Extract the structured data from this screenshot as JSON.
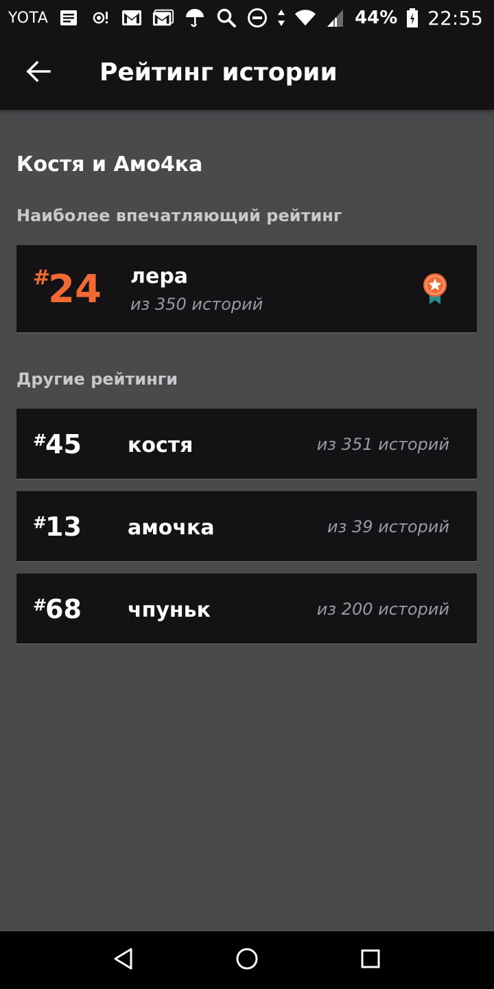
{
  "status_bar": {
    "carrier": "YOTA",
    "battery": "44%",
    "time": "22:55",
    "icons": [
      "message-icon",
      "hotspot-icon",
      "gmail-icon",
      "gmail-icon",
      "umbrella-icon",
      "search-icon",
      "dnd-icon",
      "data-arrows-icon",
      "wifi-icon",
      "signal-icon",
      "battery-icon"
    ]
  },
  "app_bar": {
    "title": "Рейтинг истории",
    "back_icon": "arrow-left-icon"
  },
  "story": {
    "name": "Костя и Амо4ка"
  },
  "best": {
    "section_label": "Наиболее впечатляющий рейтинг",
    "hash": "#",
    "rank": "24",
    "name": "лера",
    "sub": "из 350 историй",
    "badge_icon": "medal-icon",
    "accent": "#f26a33",
    "badge_ribbon": "#2a8f8f"
  },
  "others": {
    "section_label": "Другие рейтинги",
    "items": [
      {
        "hash": "#",
        "rank": "45",
        "name": "костя",
        "sub": "из 351 историй"
      },
      {
        "hash": "#",
        "rank": "13",
        "name": "амочка",
        "sub": "из 39 историй"
      },
      {
        "hash": "#",
        "rank": "68",
        "name": "чпуньк",
        "sub": "из 200 историй"
      }
    ]
  },
  "nav_bar": {
    "icons": [
      "back-triangle-icon",
      "home-circle-icon",
      "recents-square-icon"
    ]
  }
}
